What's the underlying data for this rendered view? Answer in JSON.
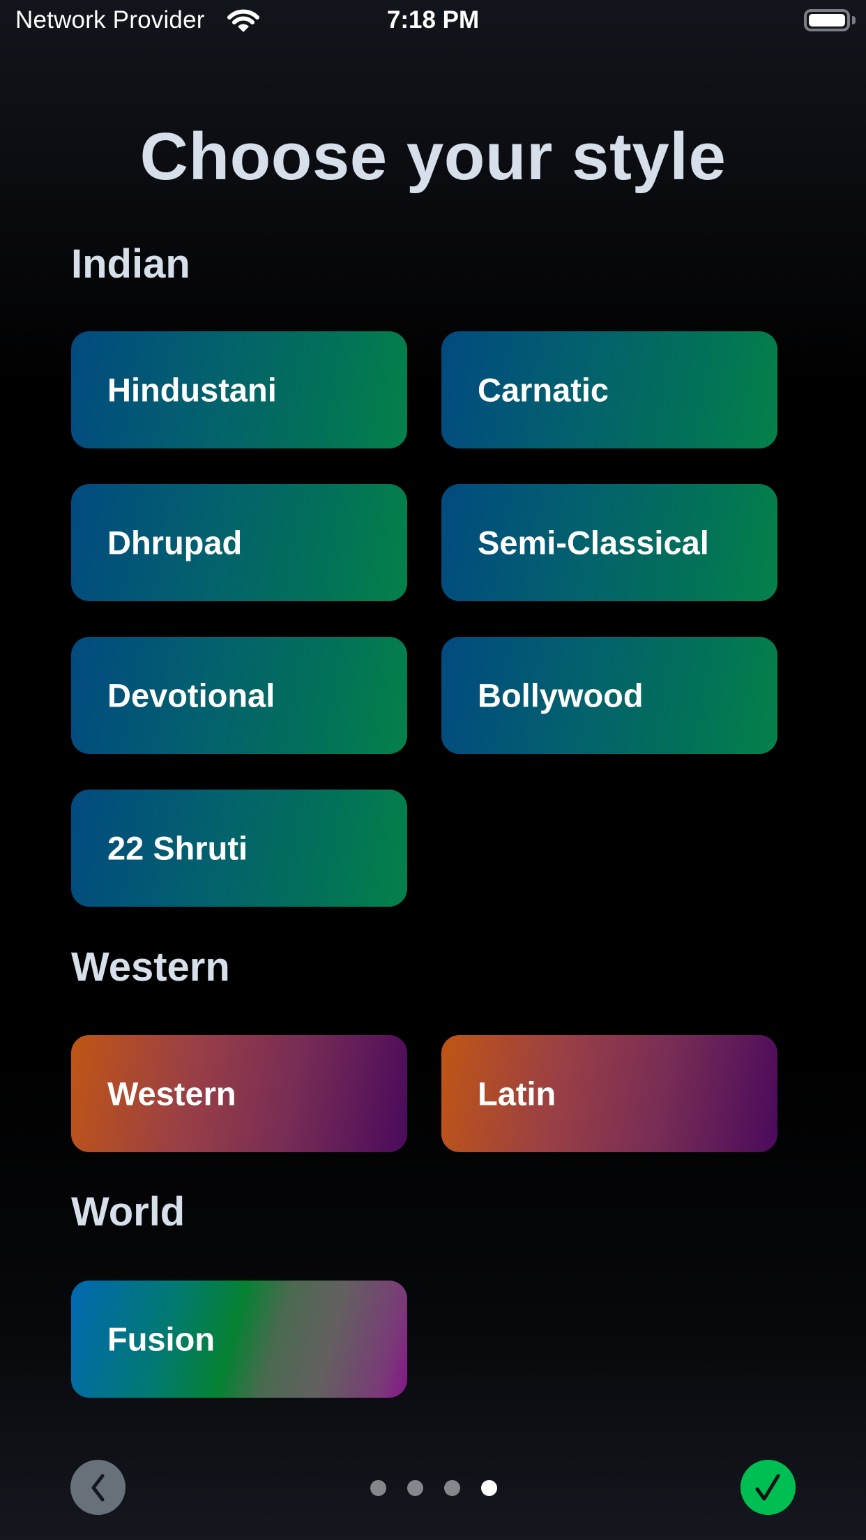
{
  "status_bar": {
    "carrier": "Network Provider",
    "time": "7:18 PM",
    "wifi_icon": "wifi-icon",
    "battery_icon": "battery-full-icon"
  },
  "page": {
    "title": "Choose your style"
  },
  "sections": [
    {
      "heading": "Indian",
      "gradient": [
        "#024a80",
        "#048149"
      ],
      "styles": [
        "Hindustani",
        "Carnatic",
        "Dhrupad",
        "Semi-Classical",
        "Devotional",
        "Bollywood",
        "22 Shruti"
      ]
    },
    {
      "heading": "Western",
      "gradient": [
        "#c05615",
        "#4a0a5c"
      ],
      "styles": [
        "Western",
        "Latin"
      ]
    },
    {
      "heading": "World",
      "gradient": [
        "#0268b2",
        "#058232",
        "#84158a"
      ],
      "styles": [
        "Fusion"
      ]
    }
  ],
  "footer": {
    "back_icon": "chevron-left-icon",
    "done_icon": "checkmark-icon",
    "page_indicator": {
      "total": 4,
      "current": 4
    },
    "colors": {
      "back": "#68707a",
      "done": "#00bf52",
      "dot": "#86878b",
      "dot_active": "#ffffff"
    }
  }
}
